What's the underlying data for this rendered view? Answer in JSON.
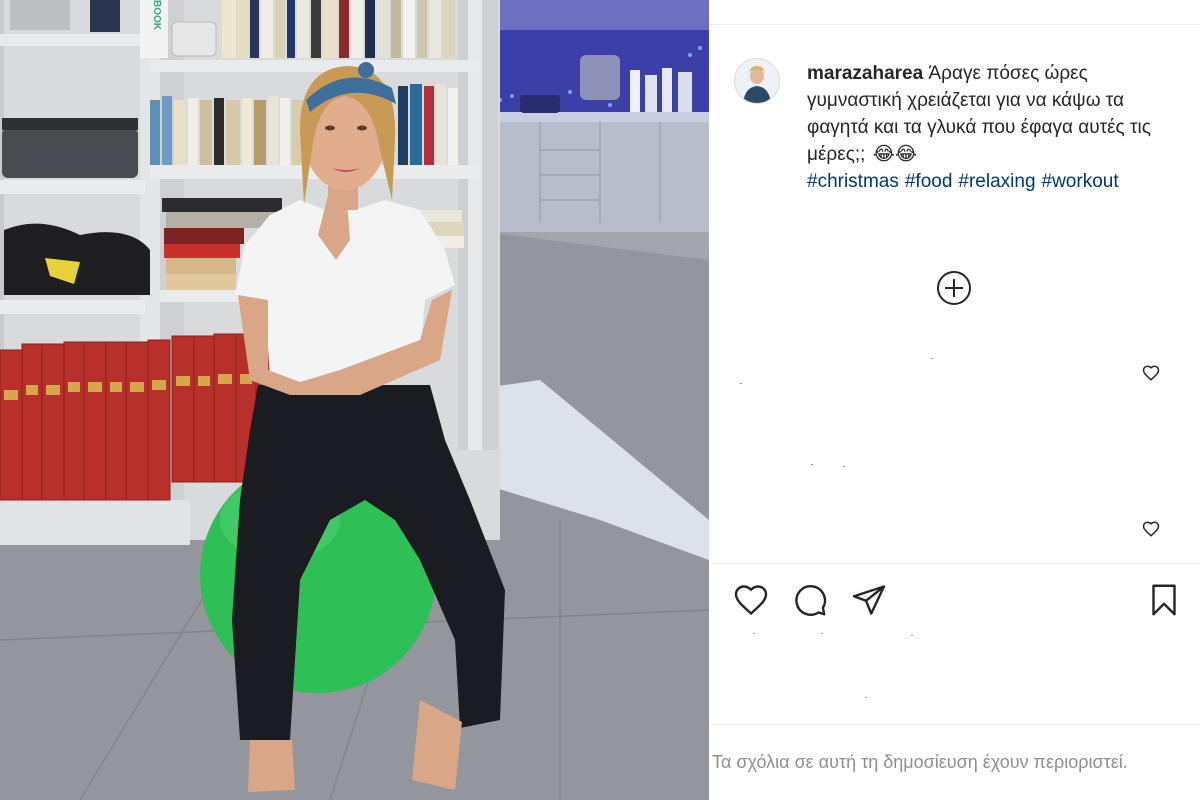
{
  "post": {
    "username": "marazaharea",
    "caption_text": "Άραγε πόσες ώρες γυμναστική χρειάζεται για να κάψω τα φαγητά και τα γλυκά που έφαγα αυτές τις μέρες;;",
    "caption_emoji": "😂😂",
    "hashtags": [
      "#christmas",
      "#food",
      "#relaxing",
      "#workout"
    ]
  },
  "comments_restricted_text": "Τα σχόλια σε αυτή τη δημοσίευση έχουν περιοριστεί.",
  "photo": {
    "book_spine_text": "BOOK"
  },
  "icons": {
    "avatar": "profile-avatar",
    "more_comments": "plus-circle-icon",
    "like": "heart-icon",
    "comment": "speech-bubble-icon",
    "share": "paper-plane-icon",
    "save": "bookmark-icon"
  },
  "colors": {
    "hashtag": "#00376b",
    "text": "#262626",
    "muted": "#8e8e8e",
    "divider": "#efefef",
    "ball": "#2fbf57"
  }
}
